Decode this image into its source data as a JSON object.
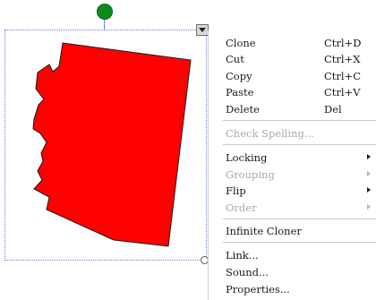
{
  "shape": {
    "name": "Arizona",
    "fill_color": "#ff0000",
    "outline_color": "#1a1a1a"
  },
  "handles": {
    "rotate_color": "#0f8a1f",
    "selection_color": "#6a7fd6"
  },
  "context_menu": {
    "items": [
      {
        "label": "Clone",
        "shortcut": "Ctrl+D",
        "enabled": true
      },
      {
        "label": "Cut",
        "shortcut": "Ctrl+X",
        "enabled": true
      },
      {
        "label": "Copy",
        "shortcut": "Ctrl+C",
        "enabled": true
      },
      {
        "label": "Paste",
        "shortcut": "Ctrl+V",
        "enabled": true
      },
      {
        "label": "Delete",
        "shortcut": "Del",
        "enabled": true
      },
      {
        "label": "Check Spelling...",
        "enabled": false
      },
      {
        "label": "Locking",
        "submenu": true,
        "enabled": true
      },
      {
        "label": "Grouping",
        "submenu": true,
        "enabled": false
      },
      {
        "label": "Flip",
        "submenu": true,
        "enabled": true
      },
      {
        "label": "Order",
        "submenu": true,
        "enabled": false
      },
      {
        "label": "Infinite Cloner",
        "enabled": true
      },
      {
        "label": "Link...",
        "enabled": true
      },
      {
        "label": "Sound...",
        "enabled": true
      },
      {
        "label": "Properties...",
        "enabled": true
      }
    ]
  }
}
